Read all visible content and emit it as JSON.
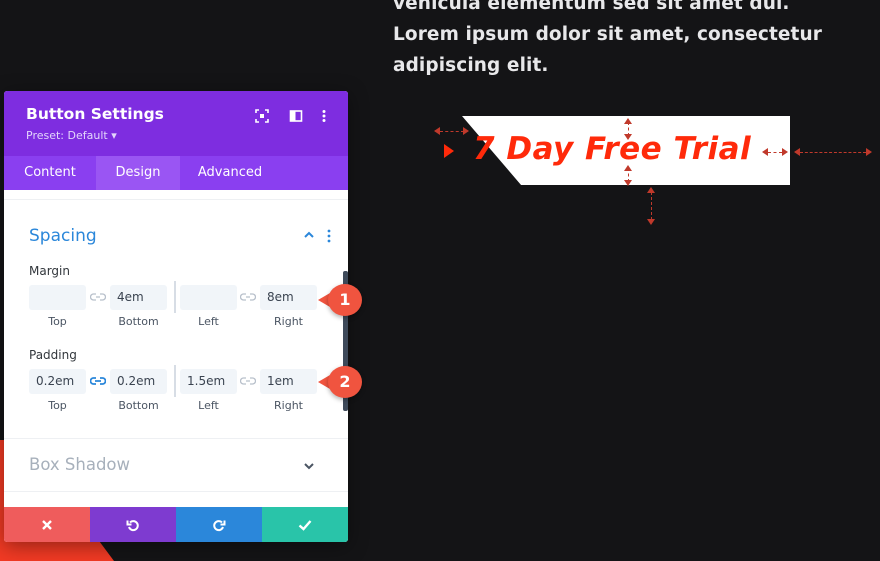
{
  "background_text": {
    "line1": "vehicula elementum sed sit amet dui.",
    "line2": "Lorem ipsum dolor sit amet, consectetur",
    "line3": "adipiscing elit."
  },
  "preview_button": {
    "label": "7 Day Free Trial",
    "text_color": "#ff2a0a",
    "bg_color": "#ffffff"
  },
  "panel": {
    "title": "Button Settings",
    "preset": "Preset: Default ▾",
    "header_icons": [
      "focus-icon",
      "split-view-icon",
      "more-vert-icon"
    ],
    "accent": "#7e2de0",
    "tabs": [
      {
        "label": "Content",
        "active": false
      },
      {
        "label": "Design",
        "active": true
      },
      {
        "label": "Advanced",
        "active": false
      }
    ],
    "section": {
      "title": "Spacing",
      "margin": {
        "label": "Margin",
        "fields": [
          {
            "label": "Top",
            "value": ""
          },
          {
            "label": "Bottom",
            "value": "4em"
          },
          {
            "label": "Left",
            "value": ""
          },
          {
            "label": "Right",
            "value": "8em"
          }
        ]
      },
      "padding": {
        "label": "Padding",
        "fields": [
          {
            "label": "Top",
            "value": "0.2em"
          },
          {
            "label": "Bottom",
            "value": "0.2em"
          },
          {
            "label": "Left",
            "value": "1.5em"
          },
          {
            "label": "Right",
            "value": "1em"
          }
        ]
      }
    },
    "box_shadow_title": "Box Shadow",
    "footer": {
      "cancel_color": "#ef5c5c",
      "undo_color": "#7e3bd0",
      "redo_color": "#2b87da",
      "save_color": "#29c4a9"
    }
  },
  "badges": {
    "one": "1",
    "two": "2"
  }
}
